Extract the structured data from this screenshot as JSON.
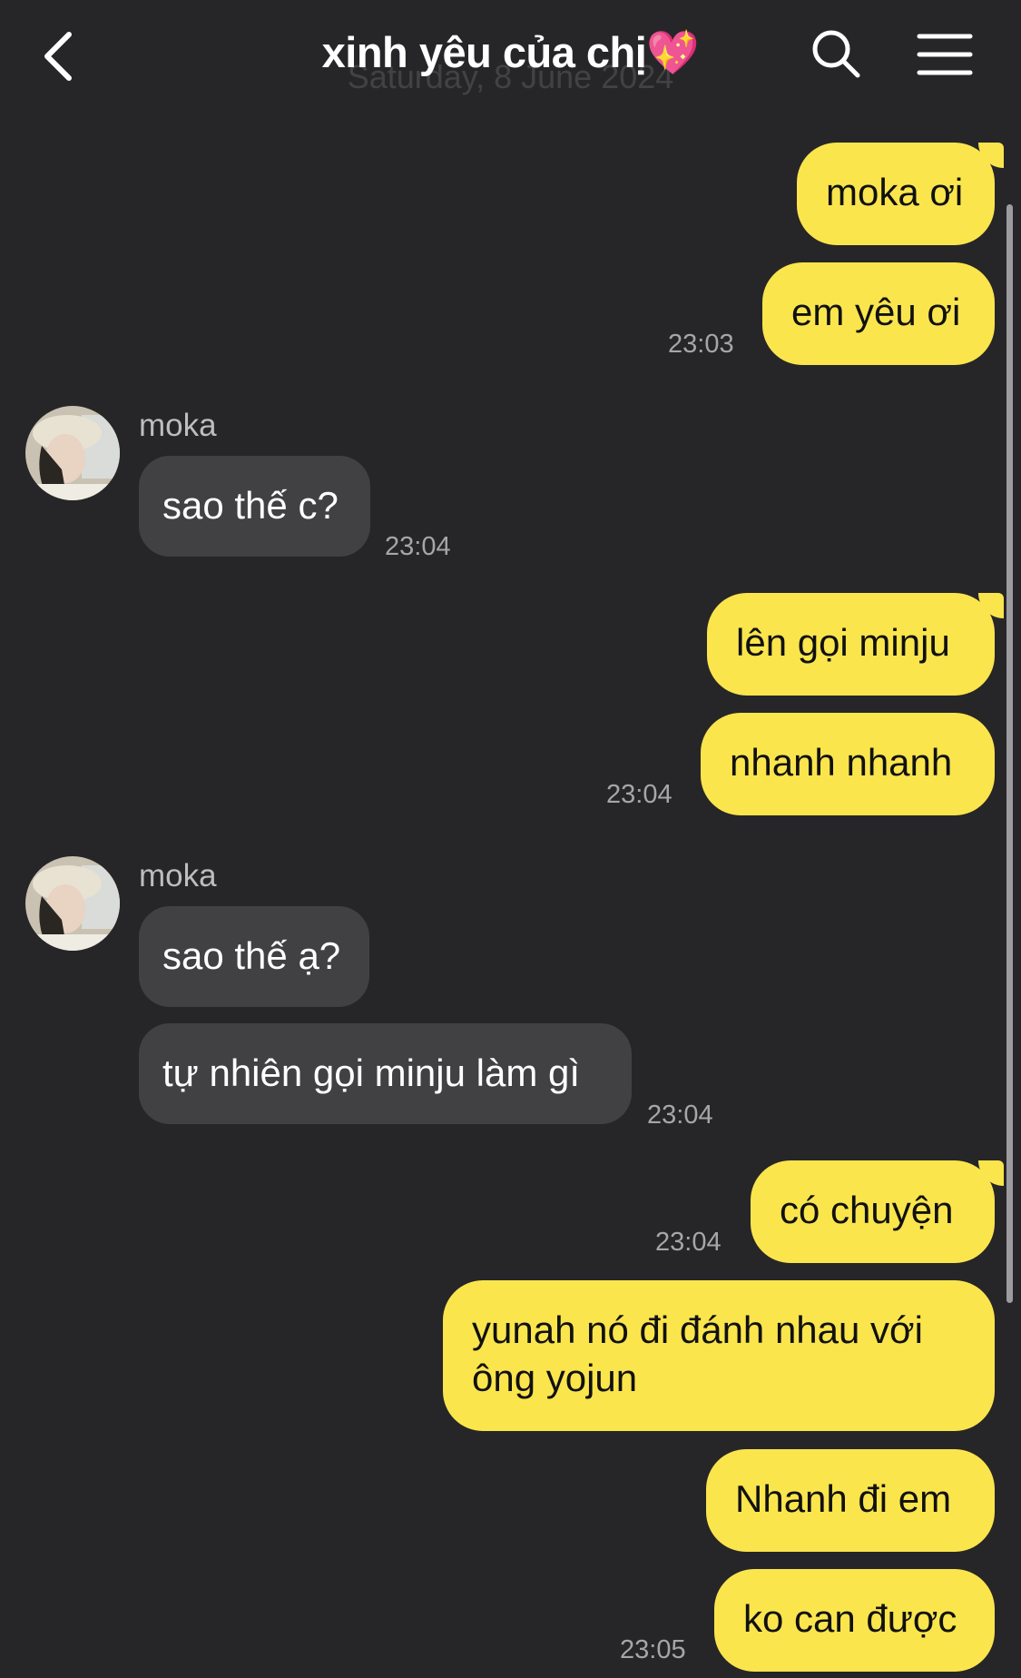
{
  "header": {
    "title": "xinh yêu của chị💖",
    "date_overlay": "Saturday, 8 June 2024"
  },
  "messages": [
    {
      "text": "moka ơi"
    },
    {
      "text": "em yêu ơi",
      "time": "23:03"
    },
    {
      "sender": "moka",
      "text": "sao thế c?",
      "time": "23:04"
    },
    {
      "text": "lên gọi minju"
    },
    {
      "text": "nhanh nhanh",
      "time": "23:04"
    },
    {
      "sender": "moka",
      "text": "sao thế ạ?"
    },
    {
      "text": "tự nhiên gọi minju làm gì",
      "time": "23:04"
    },
    {
      "text": "có chuyện",
      "time": "23:04"
    },
    {
      "text": "yunah nó đi đánh nhau với\nông yojun"
    },
    {
      "text": "Nhanh đi em"
    },
    {
      "text": "ko can được",
      "time": "23:05"
    }
  ],
  "colors": {
    "background": "#262628",
    "outgoing_bubble": "#fbe54d",
    "incoming_bubble": "#414143",
    "timestamp": "#a6a6a8"
  }
}
